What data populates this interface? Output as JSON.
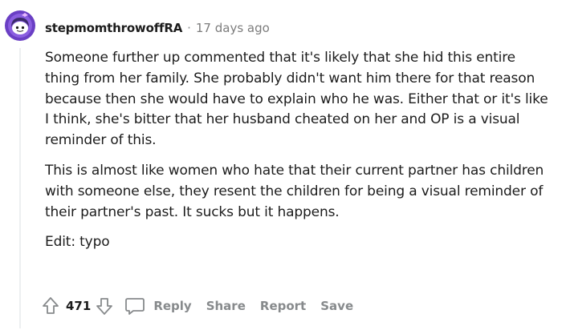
{
  "comment": {
    "author": "stepmomthrowoffRA",
    "separator": "·",
    "timestamp": "17 days ago",
    "paragraphs": [
      "Someone further up commented that it's likely that she hid this entire thing from her family. She probably didn't want him there for that reason because then she would have to explain who he was. Either that or it's like I think, she's bitter that her husband cheated on her and OP is a visual reminder of this.",
      "This is almost like women who hate that their current partner has children with someone else, they resent the children for being a visual reminder of their partner's past. It sucks but it happens.",
      "Edit: typo"
    ],
    "score": "471",
    "actions": {
      "reply": "Reply",
      "share": "Share",
      "report": "Report",
      "save": "Save"
    }
  },
  "colors": {
    "avatar_bg": "#7b4fd6",
    "meta_text": "#878a8c",
    "thread_line": "#edeff1"
  },
  "icons": [
    "upvote-icon",
    "downvote-icon",
    "reply-icon",
    "avatar-icon"
  ]
}
